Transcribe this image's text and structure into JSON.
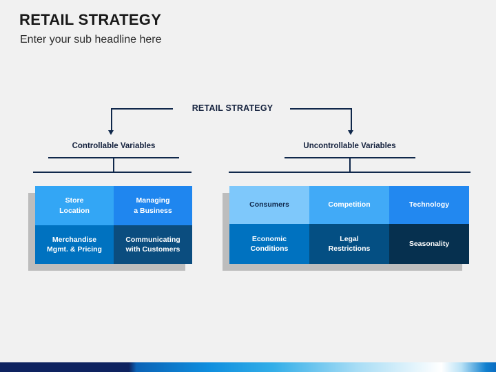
{
  "header": {
    "title": "RETAIL STRATEGY",
    "subtitle": "Enter your sub headline here"
  },
  "diagram": {
    "root_label": "RETAIL STRATEGY",
    "branches": [
      {
        "name": "controllable",
        "label": "Controllable Variables",
        "tiles": [
          {
            "label": "Store\nLocation",
            "color": "#33a6f5",
            "text_color": "#ffffff"
          },
          {
            "label": "Managing\na Business",
            "color": "#1f86ef",
            "text_color": "#ffffff"
          },
          {
            "label": "Merchandise\nMgmt. & Pricing",
            "color": "#0072c0",
            "text_color": "#ffffff"
          },
          {
            "label": "Communicating\nwith Customers",
            "color": "#0b4d7f",
            "text_color": "#ffffff"
          }
        ]
      },
      {
        "name": "uncontrollable",
        "label": "Uncontrollable Variables",
        "tiles": [
          {
            "label": "Consumers",
            "color": "#7ec8fb",
            "text_color": "#10284b"
          },
          {
            "label": "Competition",
            "color": "#41aaf7",
            "text_color": "#ffffff"
          },
          {
            "label": "Technology",
            "color": "#2288f0",
            "text_color": "#ffffff"
          },
          {
            "label": "Economic\nConditions",
            "color": "#0072c0",
            "text_color": "#ffffff"
          },
          {
            "label": "Legal\nRestrictions",
            "color": "#044f83",
            "text_color": "#ffffff"
          },
          {
            "label": "Seasonality",
            "color": "#06304f",
            "text_color": "#ffffff"
          }
        ]
      }
    ]
  },
  "colors": {
    "background": "#f1f1f1",
    "line": "#10284b",
    "shadow": "#bdbdbd",
    "title_text": "#1a1a1a"
  }
}
